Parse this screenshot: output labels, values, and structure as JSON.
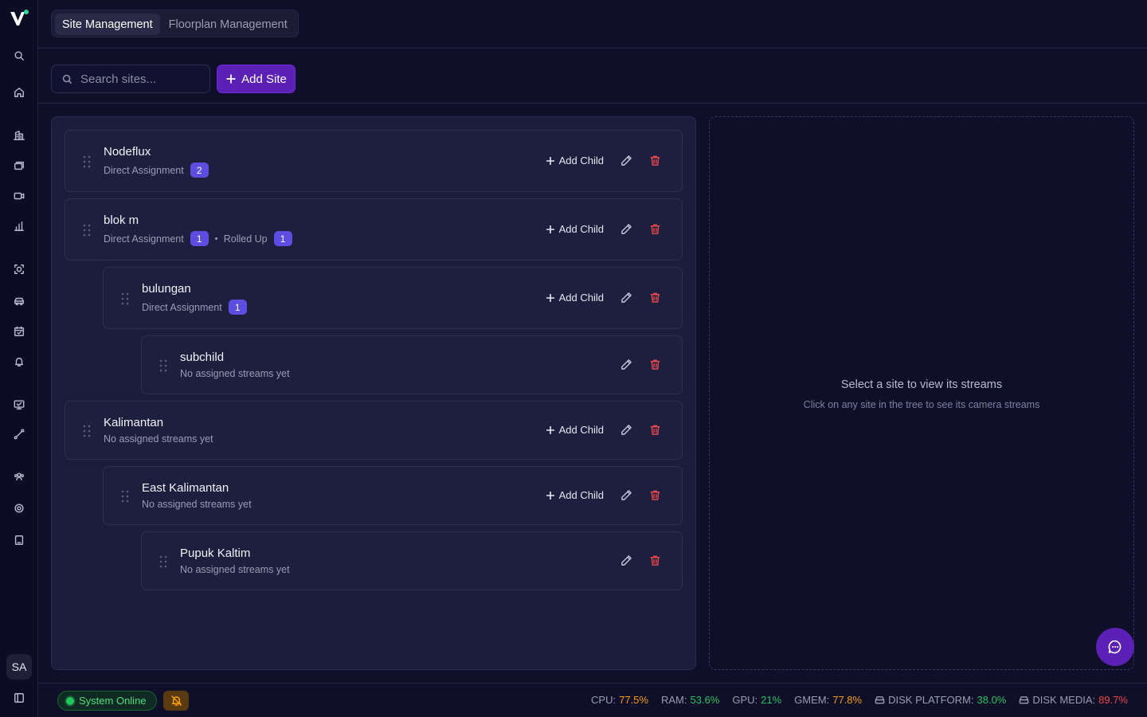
{
  "app": {
    "logo_icon": "vision-logo-icon"
  },
  "sidebar": {
    "icons": [
      "search-icon",
      "home-icon",
      "building-icon",
      "layers-icon",
      "camera-icon",
      "bar-chart-icon",
      "face-scan-icon",
      "car-icon",
      "calendar-check-icon",
      "bell-icon",
      "monitor-icon",
      "route-icon",
      "users-icon",
      "gear-icon",
      "tablet-icon",
      "panel-toggle-icon"
    ],
    "avatar": "SA"
  },
  "tabs": [
    {
      "label": "Site Management",
      "active": true
    },
    {
      "label": "Floorplan Management",
      "active": false
    }
  ],
  "toolbar": {
    "search_placeholder": "Search sites...",
    "add_site_label": "Add Site"
  },
  "tree": [
    {
      "name": "Nodeflux",
      "depth": 0,
      "direct_label": "Direct Assignment",
      "direct_count": "2",
      "can_add_child": true
    },
    {
      "name": "blok m",
      "depth": 0,
      "direct_label": "Direct Assignment",
      "direct_count": "1",
      "rolled_label": "Rolled Up",
      "rolled_count": "1",
      "can_add_child": true
    },
    {
      "name": "bulungan",
      "depth": 1,
      "direct_label": "Direct Assignment",
      "direct_count": "1",
      "can_add_child": true
    },
    {
      "name": "subchild",
      "depth": 2,
      "empty_label": "No assigned streams yet",
      "can_add_child": false
    },
    {
      "name": "Kalimantan",
      "depth": 0,
      "empty_label": "No assigned streams yet",
      "can_add_child": true
    },
    {
      "name": "East Kalimantan",
      "depth": 1,
      "empty_label": "No assigned streams yet",
      "can_add_child": true
    },
    {
      "name": "Pupuk Kaltim",
      "depth": 2,
      "empty_label": "No assigned streams yet",
      "can_add_child": false
    }
  ],
  "actions": {
    "add_child_label": "Add Child"
  },
  "streams_panel": {
    "title": "Select a site to view its streams",
    "subtitle": "Click on any site in the tree to see its camera streams"
  },
  "footer": {
    "status": "System Online",
    "metrics": [
      {
        "label": "CPU:",
        "value": "77.5%",
        "tone": "orange"
      },
      {
        "label": "RAM:",
        "value": "53.6%",
        "tone": "green"
      },
      {
        "label": "GPU:",
        "value": "21%",
        "tone": "green"
      },
      {
        "label": "GMEM:",
        "value": "77.8%",
        "tone": "orange"
      },
      {
        "label": "DISK PLATFORM:",
        "value": "38.0%",
        "tone": "green",
        "icon": "hard-drive-icon"
      },
      {
        "label": "DISK MEDIA:",
        "value": "89.7%",
        "tone": "red",
        "icon": "hard-drive-icon"
      }
    ]
  },
  "colors": {
    "accent": "#5b21b6",
    "badge": "#5b4ee0",
    "danger": "#e5484d",
    "online": "#22c55e"
  }
}
